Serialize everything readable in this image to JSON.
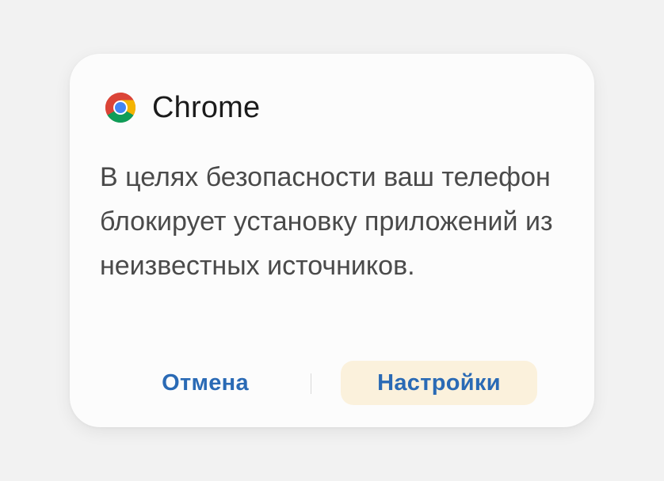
{
  "dialog": {
    "app_name": "Chrome",
    "app_icon": "chrome-icon",
    "message": "В целях безопасности ваш телефон блокирует установку приложений из неизвестных источников.",
    "cancel_label": "Отмена",
    "settings_label": "Настройки"
  },
  "colors": {
    "background": "#f2f2f2",
    "dialog": "#fcfcfc",
    "button_text": "#2a6ab5",
    "settings_button_bg": "#fbf1dc",
    "message_text": "#4a4a4a"
  }
}
